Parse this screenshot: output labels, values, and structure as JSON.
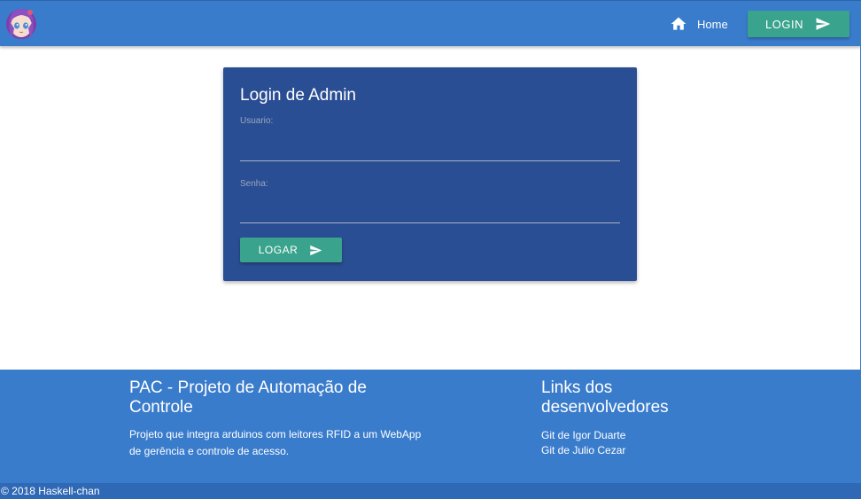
{
  "navbar": {
    "logo_icon": "anime-girl-avatar-icon",
    "home_icon": "home-icon",
    "home_label": "Home",
    "login_label": "LOGIN",
    "login_icon": "send-icon",
    "color_bg": "#3a7ccc",
    "color_button": "#3aa38d"
  },
  "login_card": {
    "title": "Login de Admin",
    "user_label": "Usuario:",
    "user_value": "",
    "password_label": "Senha:",
    "password_value": "",
    "submit_label": "LOGAR",
    "submit_icon": "send-icon",
    "color_bg": "#2a4e93"
  },
  "footer": {
    "project_title": "PAC - Projeto de Automação de Controle",
    "project_description": "Projeto que integra arduinos com leitores RFID a um WebApp de gerência e controle de acesso.",
    "links_title": "Links dos desenvolvedores",
    "links": [
      "Git de Igor Duarte",
      "Git de Julio Cezar"
    ],
    "copyright": "© 2018 Haskell-chan"
  }
}
